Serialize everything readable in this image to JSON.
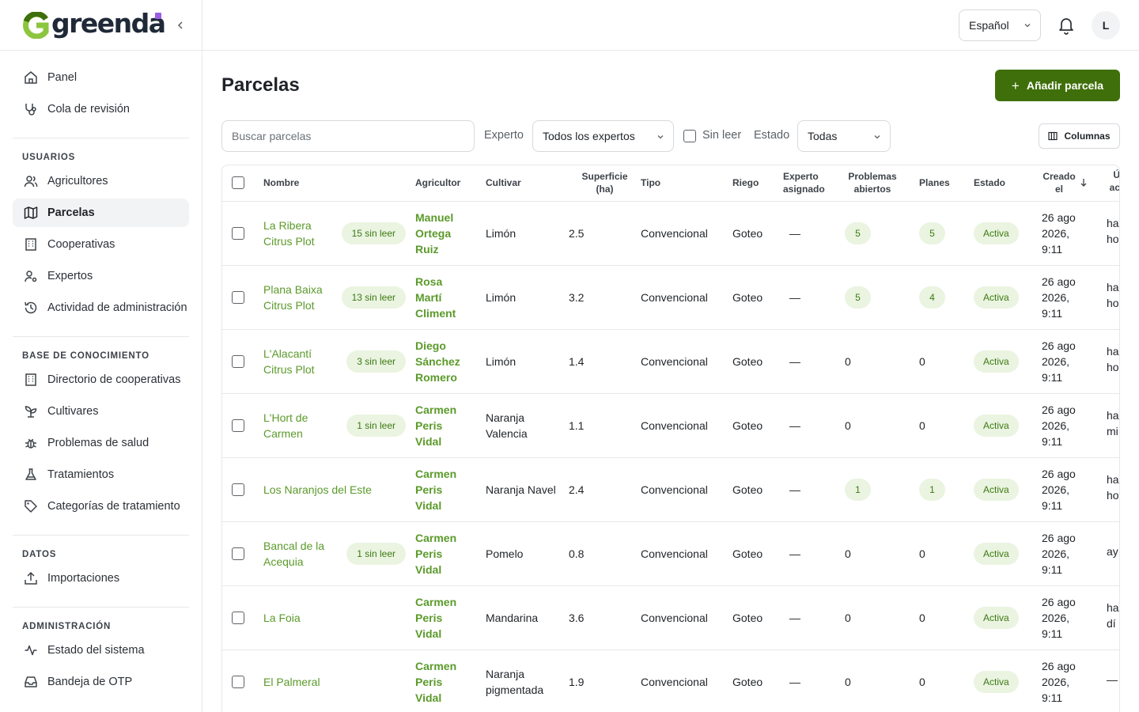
{
  "brand": {
    "name": "greenda",
    "accent": "#3f6f0a",
    "logo_green": "#8cc63f",
    "dot": "#9b5de5"
  },
  "sidebar": {
    "groups": [
      {
        "title": "",
        "items": [
          {
            "label": "Panel",
            "icon": "home-icon"
          },
          {
            "label": "Cola de revisión",
            "icon": "stethoscope-icon"
          }
        ]
      },
      {
        "title": "USUARIOS",
        "items": [
          {
            "label": "Agricultores",
            "icon": "users-icon"
          },
          {
            "label": "Parcelas",
            "icon": "map-icon",
            "active": true
          },
          {
            "label": "Cooperativas",
            "icon": "building-icon"
          },
          {
            "label": "Expertos",
            "icon": "user-cog-icon"
          },
          {
            "label": "Actividad de administración",
            "icon": "history-icon"
          }
        ]
      },
      {
        "title": "BASE DE CONOCIMIENTO",
        "items": [
          {
            "label": "Directorio de cooperativas",
            "icon": "building-icon"
          },
          {
            "label": "Cultivares",
            "icon": "sprout-icon"
          },
          {
            "label": "Problemas de salud",
            "icon": "bug-icon"
          },
          {
            "label": "Tratamientos",
            "icon": "flask-icon"
          },
          {
            "label": "Categorías de tratamiento",
            "icon": "tag-icon"
          }
        ]
      },
      {
        "title": "DATOS",
        "items": [
          {
            "label": "Importaciones",
            "icon": "upload-icon"
          }
        ]
      },
      {
        "title": "ADMINISTRACIÓN",
        "items": [
          {
            "label": "Estado del sistema",
            "icon": "activity-icon"
          },
          {
            "label": "Bandeja de OTP",
            "icon": "inbox-icon"
          }
        ]
      }
    ]
  },
  "topbar": {
    "language": "Español",
    "avatar_initial": "L"
  },
  "page": {
    "title": "Parcelas",
    "add_button": "Añadir parcela",
    "search_placeholder": "Buscar parcelas",
    "expert_label": "Experto",
    "expert_value": "Todos los expertos",
    "unread_label": "Sin leer",
    "status_label": "Estado",
    "status_value": "Todas",
    "columns_button": "Columnas"
  },
  "table": {
    "headers": {
      "name": "Nombre",
      "farmer": "Agricultor",
      "cultivar": "Cultivar",
      "area": "Superficie (ha)",
      "type": "Tipo",
      "irrigation": "Riego",
      "expert": "Experto asignado",
      "problems": "Problemas abiertos",
      "plans": "Planes",
      "status": "Estado",
      "created": "Creado el",
      "last": "Ú ac"
    },
    "rows": [
      {
        "name": "La Ribera Citrus Plot",
        "unread": "15 sin leer",
        "farmer": "Manuel Ortega Ruiz",
        "cultivar": "Limón",
        "area": "2.5",
        "type": "Convencional",
        "irrigation": "Goteo",
        "expert": "—",
        "problems": "5",
        "problems_pill": true,
        "plans": "5",
        "plans_pill": true,
        "status": "Activa",
        "created": "26 ago 2026, 9:11",
        "last": "ha ho"
      },
      {
        "name": "Plana Baixa Citrus Plot",
        "unread": "13 sin leer",
        "farmer": "Rosa Martí Climent",
        "cultivar": "Limón",
        "area": "3.2",
        "type": "Convencional",
        "irrigation": "Goteo",
        "expert": "—",
        "problems": "5",
        "problems_pill": true,
        "plans": "4",
        "plans_pill": true,
        "status": "Activa",
        "created": "26 ago 2026, 9:11",
        "last": "ha ho"
      },
      {
        "name": "L'Alacantí Citrus Plot",
        "unread": "3 sin leer",
        "farmer": "Diego Sánchez Romero",
        "cultivar": "Limón",
        "area": "1.4",
        "type": "Convencional",
        "irrigation": "Goteo",
        "expert": "—",
        "problems": "0",
        "problems_pill": false,
        "plans": "0",
        "plans_pill": false,
        "status": "Activa",
        "created": "26 ago 2026, 9:11",
        "last": "ha ho"
      },
      {
        "name": "L'Hort de Carmen",
        "unread": "1 sin leer",
        "farmer": "Carmen Peris Vidal",
        "cultivar": "Naranja Valencia",
        "area": "1.1",
        "type": "Convencional",
        "irrigation": "Goteo",
        "expert": "—",
        "problems": "0",
        "problems_pill": false,
        "plans": "0",
        "plans_pill": false,
        "status": "Activa",
        "created": "26 ago 2026, 9:11",
        "last": "ha mi"
      },
      {
        "name": "Los Naranjos del Este",
        "unread": "",
        "farmer": "Carmen Peris Vidal",
        "cultivar": "Naranja Navel",
        "area": "2.4",
        "type": "Convencional",
        "irrigation": "Goteo",
        "expert": "—",
        "problems": "1",
        "problems_pill": true,
        "plans": "1",
        "plans_pill": true,
        "status": "Activa",
        "created": "26 ago 2026, 9:11",
        "last": "ha ho"
      },
      {
        "name": "Bancal de la Acequia",
        "unread": "1 sin leer",
        "farmer": "Carmen Peris Vidal",
        "cultivar": "Pomelo",
        "area": "0.8",
        "type": "Convencional",
        "irrigation": "Goteo",
        "expert": "—",
        "problems": "0",
        "problems_pill": false,
        "plans": "0",
        "plans_pill": false,
        "status": "Activa",
        "created": "26 ago 2026, 9:11",
        "last": "ay"
      },
      {
        "name": "La Foia",
        "unread": "",
        "farmer": "Carmen Peris Vidal",
        "cultivar": "Mandarina",
        "area": "3.6",
        "type": "Convencional",
        "irrigation": "Goteo",
        "expert": "—",
        "problems": "0",
        "problems_pill": false,
        "plans": "0",
        "plans_pill": false,
        "status": "Activa",
        "created": "26 ago 2026, 9:11",
        "last": "ha día"
      },
      {
        "name": "El Palmeral",
        "unread": "",
        "farmer": "Carmen Peris Vidal",
        "cultivar": "Naranja pigmentada",
        "area": "1.9",
        "type": "Convencional",
        "irrigation": "Goteo",
        "expert": "—",
        "problems": "0",
        "problems_pill": false,
        "plans": "0",
        "plans_pill": false,
        "status": "Activa",
        "created": "26 ago 2026, 9:11",
        "last": "—"
      }
    ]
  }
}
